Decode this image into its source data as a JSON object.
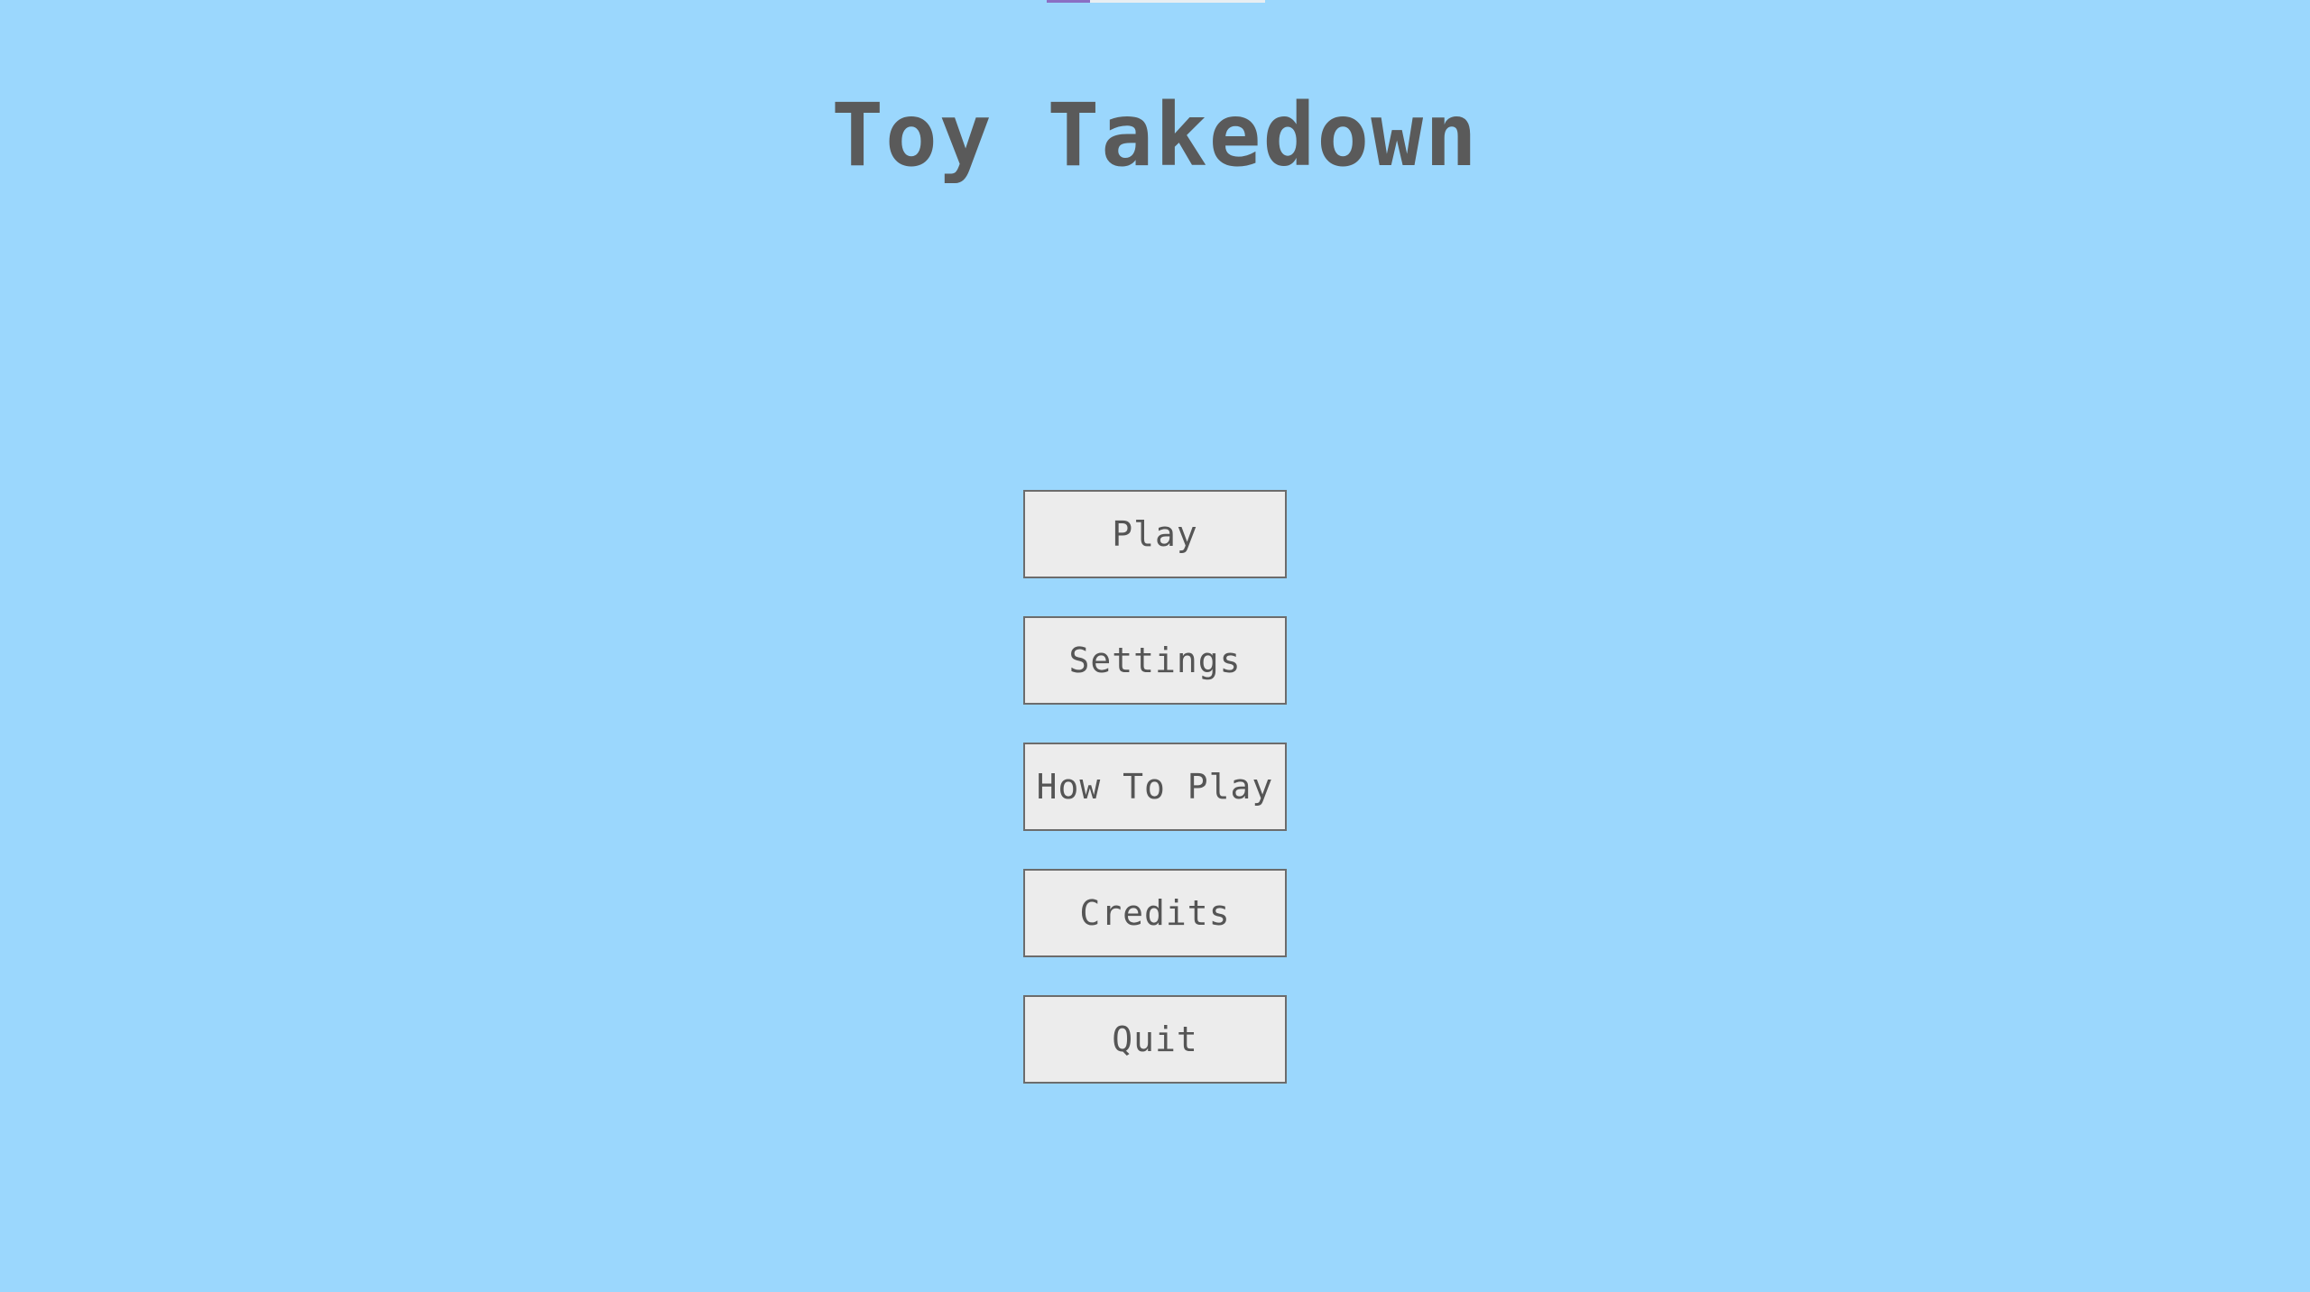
{
  "game": {
    "title": "Toy Takedown"
  },
  "menu": {
    "buttons": [
      {
        "label": "Play"
      },
      {
        "label": "Settings"
      },
      {
        "label": "How To Play"
      },
      {
        "label": "Credits"
      },
      {
        "label": "Quit"
      }
    ]
  },
  "colors": {
    "background": "#9bd7fd",
    "button_fill": "#ececec",
    "text": "#5a5a5a"
  }
}
